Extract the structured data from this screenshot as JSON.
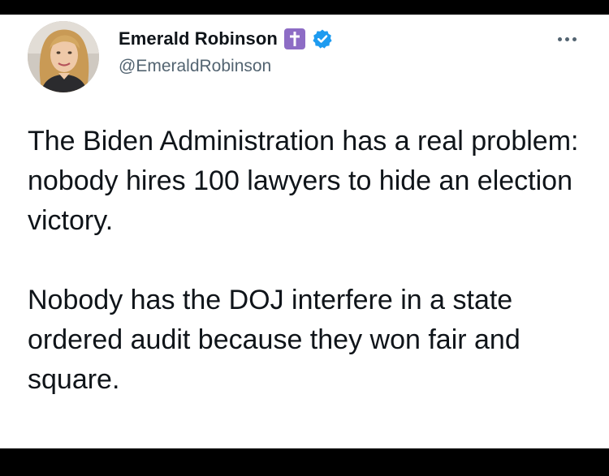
{
  "author": {
    "display_name": "Emerald Robinson",
    "handle": "@EmeraldRobinson",
    "avatar_icon": "profile-photo",
    "badges": [
      "cross-icon",
      "verified-icon"
    ]
  },
  "tweet": {
    "paragraphs": [
      "The Biden Administration has a real problem: nobody hires 100 lawyers to hide an election victory.",
      "Nobody has the DOJ interfere in a state ordered audit because they won fair and square."
    ]
  },
  "menu": {
    "icon": "more-options-icon"
  },
  "colors": {
    "background": "#000000",
    "card": "#ffffff",
    "text": "#0f1419",
    "secondary_text": "#536471",
    "verified_blue": "#1d9bf0",
    "cross_badge": "#8d6cc5"
  }
}
